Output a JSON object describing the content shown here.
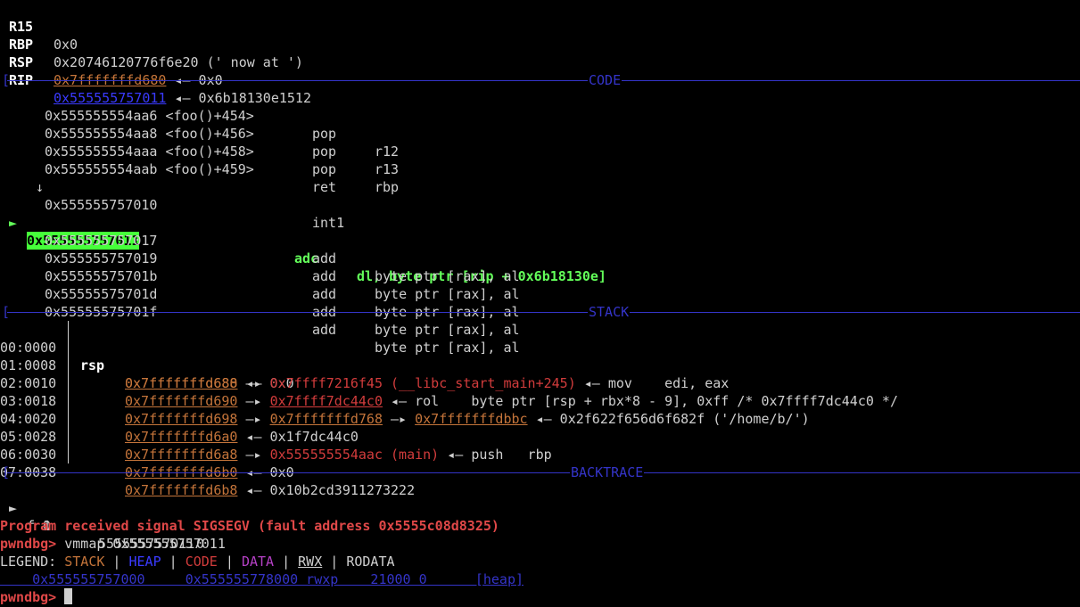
{
  "registers": [
    {
      "name": "R15",
      "value": "0x0"
    },
    {
      "name": "RBP",
      "value": "0x20746120776f6e20 (' now at ')"
    },
    {
      "name": "RSP",
      "addr": "0x7fffffffd680",
      "rest": " ◂— 0x0"
    },
    {
      "name": "RIP",
      "addr": "0x555555757011",
      "rest": " ◂— 0x6b18130e1512"
    }
  ],
  "sections": {
    "code": "CODE",
    "stack": "STACK",
    "backtrace": "BACKTRACE"
  },
  "code": {
    "lines": [
      {
        "addr": "0x555555554aa6 <foo()+454>",
        "op": "pop",
        "args": "r12"
      },
      {
        "addr": "0x555555554aa8 <foo()+456>",
        "op": "pop",
        "args": "r13"
      },
      {
        "addr": "0x555555554aaa <foo()+458>",
        "op": "pop",
        "args": "rbp"
      },
      {
        "addr": "0x555555554aab <foo()+459>",
        "op": "ret",
        "args": ""
      }
    ],
    "arrow": "↓",
    "int1_addr": "0x555555757010",
    "int1_op": "int1",
    "current_marker": "►",
    "current_addr": "0x555555757011",
    "current_op": "adc",
    "current_args": "dl, byte ptr [rip + 0x6b18130e]",
    "after": [
      {
        "addr": "0x555555757017",
        "op": "add",
        "args": "byte ptr [rax], al"
      },
      {
        "addr": "0x555555757019",
        "op": "add",
        "args": "byte ptr [rax], al"
      },
      {
        "addr": "0x55555575701b",
        "op": "add",
        "args": "byte ptr [rax], al"
      },
      {
        "addr": "0x55555575701d",
        "op": "add",
        "args": "byte ptr [rax], al"
      },
      {
        "addr": "0x55555575701f",
        "op": "add",
        "args": "byte ptr [rax], al"
      }
    ]
  },
  "stack": [
    {
      "off": "00:0000",
      "reg": "rsp",
      "addr": "0x7fffffffd680",
      "rest": " ◂— 0x0"
    },
    {
      "off": "01:0008",
      "reg": "",
      "addr": "0x7fffffffd688",
      "arrow": " —▸ ",
      "red": "0x7ffff7216f45 (__libc_start_main+245)",
      "rest": " ◂— mov    edi, eax"
    },
    {
      "off": "02:0010",
      "reg": "",
      "addr": "0x7fffffffd690",
      "arrow": " —▸ ",
      "redu": "0x7ffff7dc44c0",
      "rest": " ◂— rol    byte ptr [rsp + rbx*8 - 9], 0xff /* 0x7ffff7dc44c0 */"
    },
    {
      "off": "03:0018",
      "reg": "",
      "addr": "0x7fffffffd698",
      "arrow": " —▸ ",
      "addr2": "0x7fffffffd768",
      "arrow2": " —▸ ",
      "addr3": "0x7fffffffdbbc",
      "rest": " ◂— 0x2f622f656d6f682f ('/home/b/')"
    },
    {
      "off": "04:0020",
      "reg": "",
      "addr": "0x7fffffffd6a0",
      "rest": " ◂— 0x1f7dc44c0"
    },
    {
      "off": "05:0028",
      "reg": "",
      "addr": "0x7fffffffd6a8",
      "arrow": " —▸ ",
      "red": "0x555555554aac (main)",
      "rest": " ◂— push   rbp"
    },
    {
      "off": "06:0030",
      "reg": "",
      "addr": "0x7fffffffd6b0",
      "rest": " ◂— 0x0"
    },
    {
      "off": "07:0038",
      "reg": "",
      "addr": "0x7fffffffd6b8",
      "rest": " ◂— 0x10b2cd3911273222"
    }
  ],
  "backtrace": [
    {
      "marker": "►",
      "frame": "f 0",
      "addr": "555555757011"
    },
    {
      "marker": "",
      "frame": "f 1",
      "addr": "0"
    }
  ],
  "signal_line": "Program received signal SIGSEGV (fault address 0x5555c08d8325)",
  "prompt": "pwndbg>",
  "command": " vmmap 0x555555757011",
  "legend": {
    "prefix": "LEGEND: ",
    "stack": "STACK",
    "heap": "HEAP",
    "code": "CODE",
    "data": "DATA",
    "rwx": "RWX",
    "rodata": "RODATA",
    "sep": " | "
  },
  "vmmap_line": "    0x555555757000     0x555555778000 rwxp    21000 0      [heap]",
  "colors": {
    "orange": "#c4743a",
    "blue": "#3a3aff",
    "green": "#63ff5a",
    "red": "#d23c3c",
    "separator": "#3434c8"
  }
}
